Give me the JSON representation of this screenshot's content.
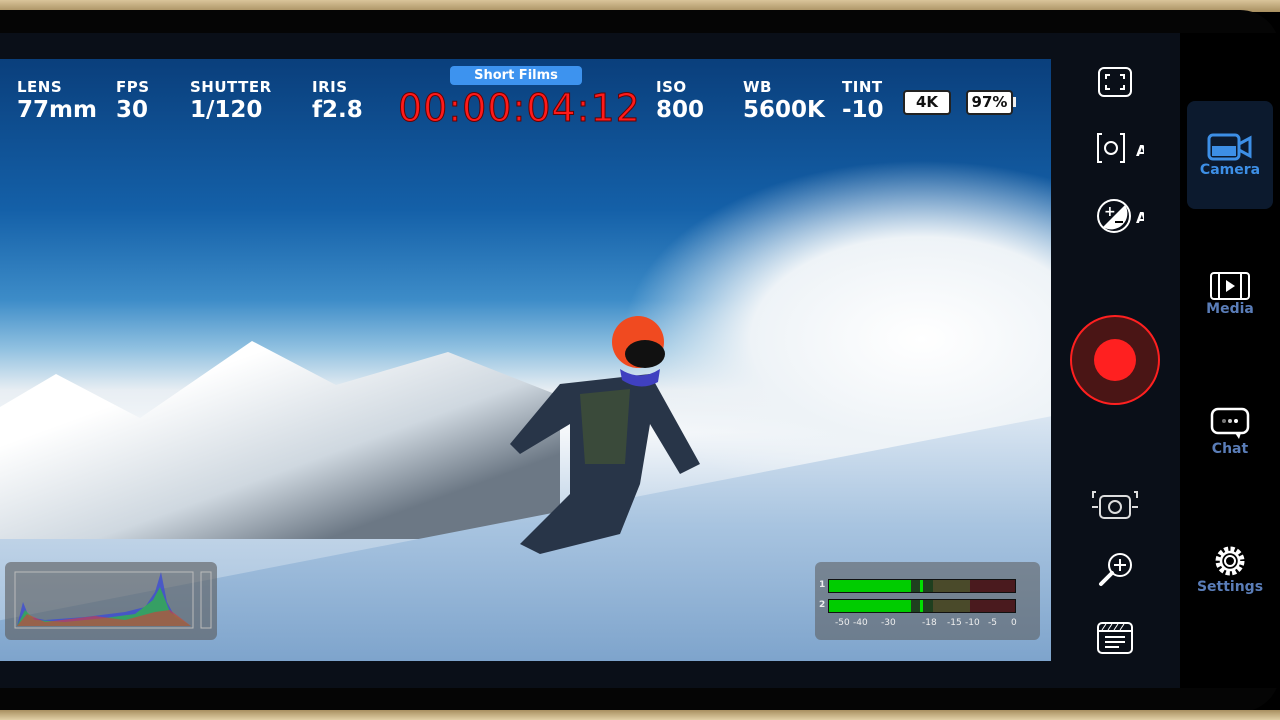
{
  "hud": {
    "lens": {
      "label": "LENS",
      "value": "77mm"
    },
    "fps": {
      "label": "FPS",
      "value": "30"
    },
    "shutter": {
      "label": "SHUTTER",
      "value": "1/120"
    },
    "iris": {
      "label": "IRIS",
      "value": "f2.8"
    },
    "preset": "Short Films",
    "timecode": "00:00:04:12",
    "iso": {
      "label": "ISO",
      "value": "800"
    },
    "wb": {
      "label": "WB",
      "value": "5600K"
    },
    "tint": {
      "label": "TINT",
      "value": "-10"
    },
    "resolution": "4K",
    "battery": "97%"
  },
  "audio_meter": {
    "channels": [
      "1",
      "2"
    ],
    "scale": [
      "-50",
      "-40",
      "-30",
      "-18",
      "-15",
      "-10",
      "-5",
      "0"
    ],
    "level_db": -22,
    "colors": {
      "green": "#00cc00",
      "olive": "#4a4a2a",
      "red": "#4a1a1e"
    }
  },
  "controls": [
    "frame-guides-icon",
    "auto-focus-icon",
    "auto-exposure-icon",
    "record-button",
    "snapshot-icon",
    "zoom-in-icon",
    "clapper-slate-icon"
  ],
  "nav": [
    {
      "label": "Camera",
      "icon": "video-camera-icon",
      "active": true
    },
    {
      "label": "Media",
      "icon": "film-icon",
      "active": false
    },
    {
      "label": "Chat",
      "icon": "chat-bubble-icon",
      "active": false
    },
    {
      "label": "Settings",
      "icon": "gear-icon",
      "active": false
    }
  ],
  "colors": {
    "record": "#ff2020",
    "timecode": "#ff1a1a",
    "accent": "#3d93ef"
  }
}
